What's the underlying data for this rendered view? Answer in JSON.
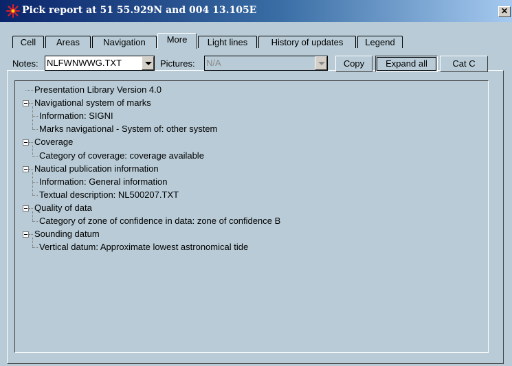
{
  "window": {
    "title": "Pick report at 51 55.929N and 004 13.105E",
    "close_label": "✕",
    "app_icon": "asterisk-star-icon",
    "colors": {
      "titlebar": "#0a246a",
      "client": "#b8cbd6",
      "icon": "#e0202a"
    }
  },
  "tabs": [
    {
      "label": "Cell",
      "active": false
    },
    {
      "label": "Areas",
      "active": false
    },
    {
      "label": "Navigation",
      "active": false
    },
    {
      "label": "More",
      "active": true
    },
    {
      "label": "Light lines",
      "active": false
    },
    {
      "label": "History of updates",
      "active": false
    },
    {
      "label": "Legend",
      "active": false
    }
  ],
  "toolbar": {
    "notes_label": "Notes:",
    "notes_value": "NLFWNWWG.TXT",
    "pictures_label": "Pictures:",
    "pictures_value": "N/A",
    "copy_label": "Copy",
    "expand_all_label": "Expand all",
    "catc_label": "Cat C"
  },
  "tree": [
    {
      "text": "Presentation Library Version 4.0",
      "level": 0,
      "expandable": false
    },
    {
      "text": "Navigational system of marks",
      "level": 0,
      "expandable": true
    },
    {
      "text": "Information:  SIGNI",
      "level": 1,
      "expandable": false
    },
    {
      "text": "Marks navigational - System of:  other system",
      "level": 1,
      "expandable": false
    },
    {
      "text": "Coverage",
      "level": 0,
      "expandable": true
    },
    {
      "text": "Category of coverage:  coverage available",
      "level": 1,
      "expandable": false
    },
    {
      "text": "Nautical publication information",
      "level": 0,
      "expandable": true
    },
    {
      "text": "Information:  General information",
      "level": 1,
      "expandable": false
    },
    {
      "text": "Textual description:  NL500207.TXT",
      "level": 1,
      "expandable": false
    },
    {
      "text": "Quality of data",
      "level": 0,
      "expandable": true
    },
    {
      "text": "Category of zone of confidence in data:  zone of confidence B",
      "level": 1,
      "expandable": false
    },
    {
      "text": "Sounding datum",
      "level": 0,
      "expandable": true
    },
    {
      "text": "Vertical datum:  Approximate lowest astronomical tide",
      "level": 1,
      "expandable": false
    }
  ]
}
